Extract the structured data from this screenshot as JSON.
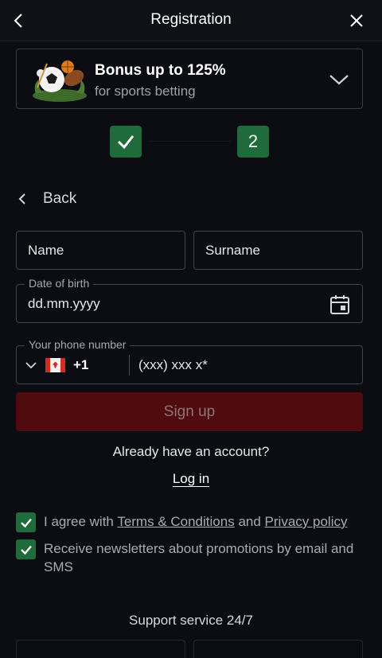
{
  "header": {
    "title": "Registration",
    "back_icon": "chevron-left-icon",
    "close_icon": "close-icon"
  },
  "bonus": {
    "title": "Bonus up to 125%",
    "subtitle": "for sports betting",
    "expand_icon": "chevron-down-icon"
  },
  "steps": {
    "step1": "completed",
    "step2_label": "2"
  },
  "back_link": {
    "label": "Back"
  },
  "form": {
    "name_placeholder": "Name",
    "surname_placeholder": "Surname",
    "dob_label": "Date of birth",
    "dob_placeholder": "dd.mm.yyyy",
    "phone_label": "Your phone number",
    "phone_country_code": "+1",
    "phone_placeholder": "(xxx) xxx x*",
    "signup_label": "Sign up"
  },
  "account": {
    "already_text": "Already have an account?",
    "login_label": "Log in"
  },
  "agreements": {
    "terms_prefix": "I agree with",
    "terms_link": "Terms & Conditions",
    "terms_and": "and",
    "privacy_link": "Privacy policy",
    "terms_checked": true,
    "newsletter_text": "Receive newsletters about promotions by email and SMS",
    "newsletter_checked": true
  },
  "support": {
    "title": "Support service 24/7"
  },
  "colors": {
    "accent_green": "#1f6b3b",
    "signup_disabled": "#500b0f",
    "background": "#0c0d12"
  }
}
